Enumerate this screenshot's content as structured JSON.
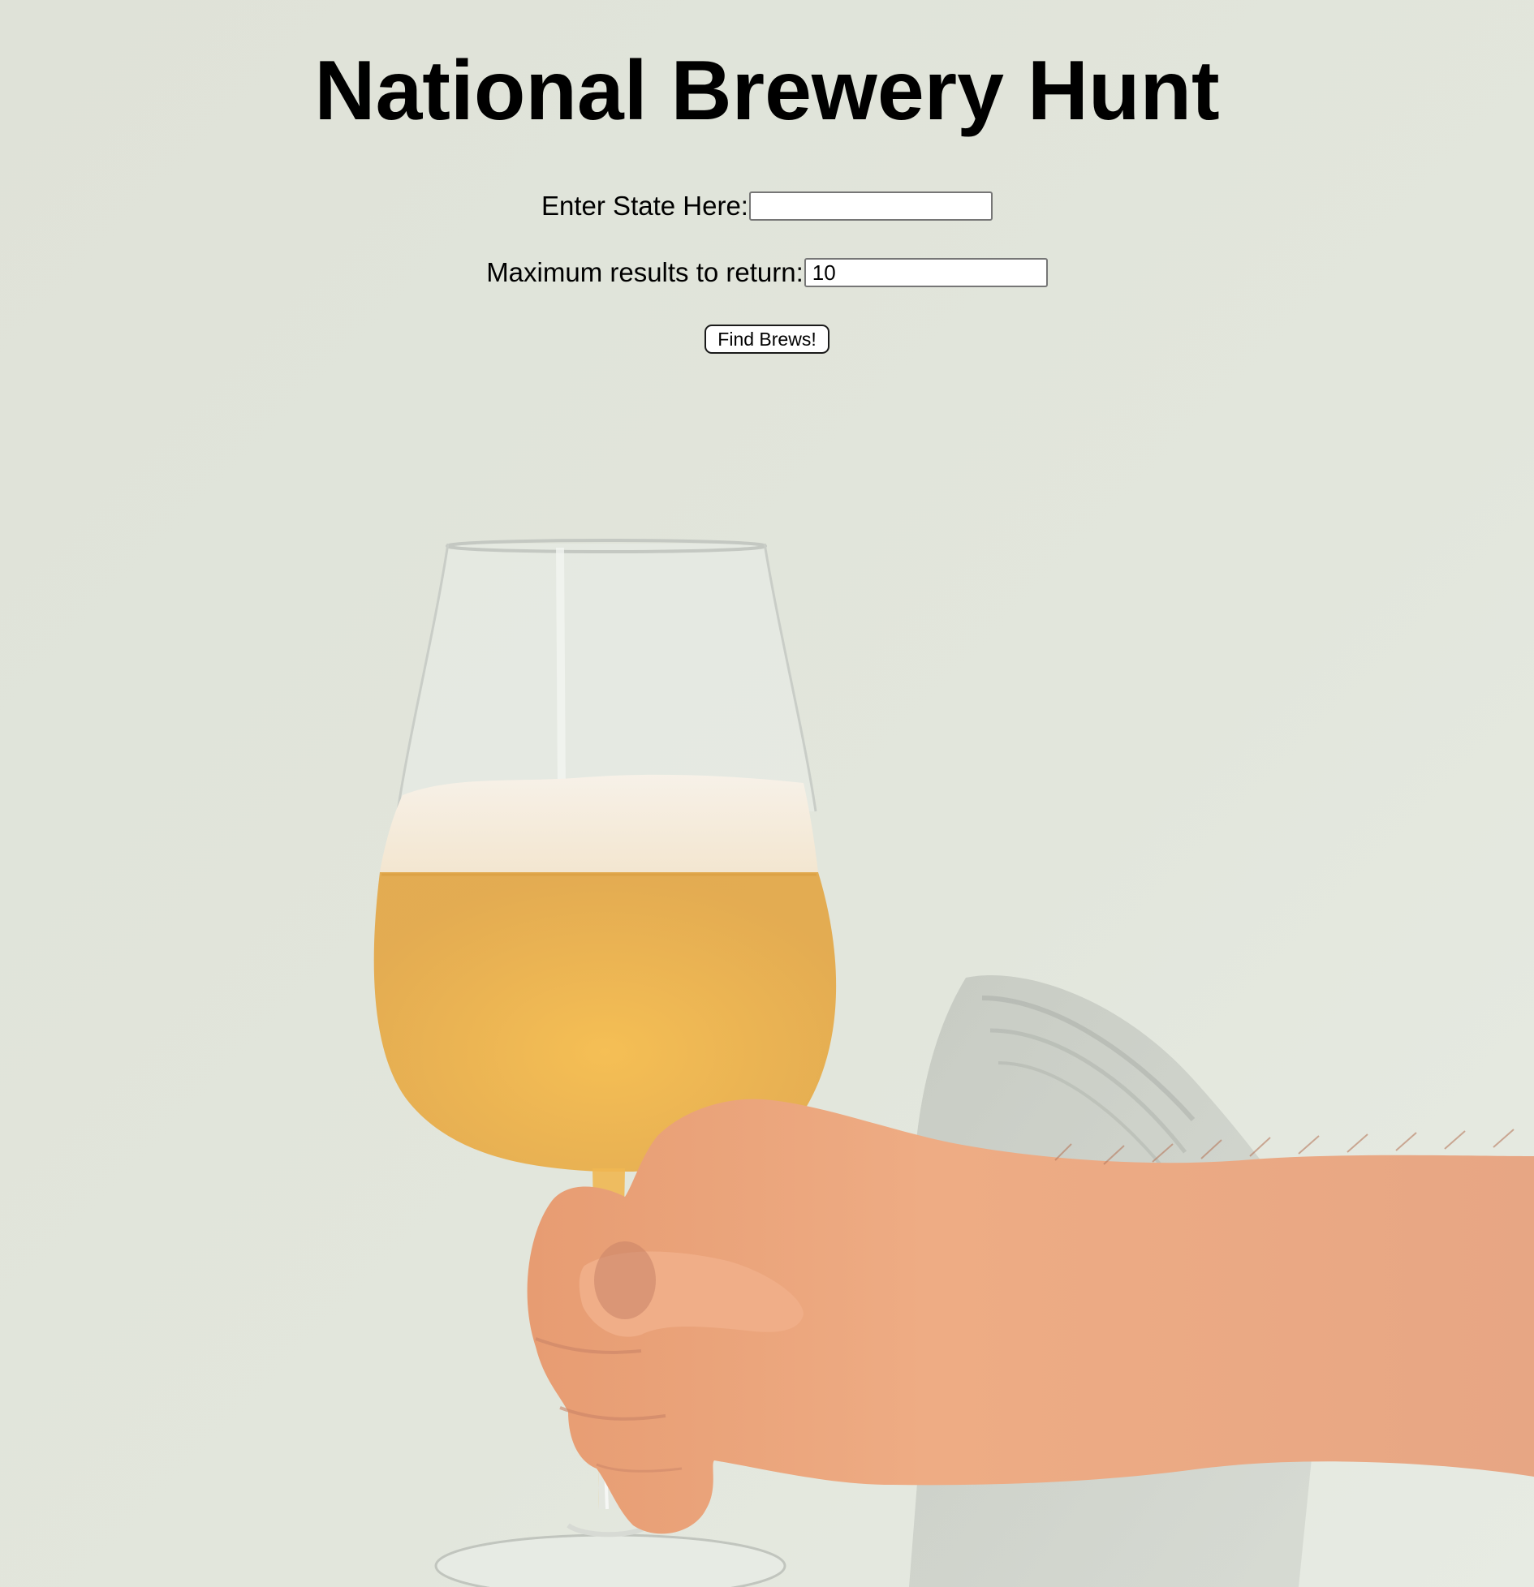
{
  "page": {
    "title": "National Brewery Hunt",
    "background_color": "#dfe2d8"
  },
  "form": {
    "state_label": "Enter State Here:",
    "state_value": "",
    "max_label": "Maximum results to return:",
    "max_value": "10",
    "submit_label": "Find Brews!"
  },
  "background_image": {
    "icon": "beer-glass-in-hand-photo"
  }
}
